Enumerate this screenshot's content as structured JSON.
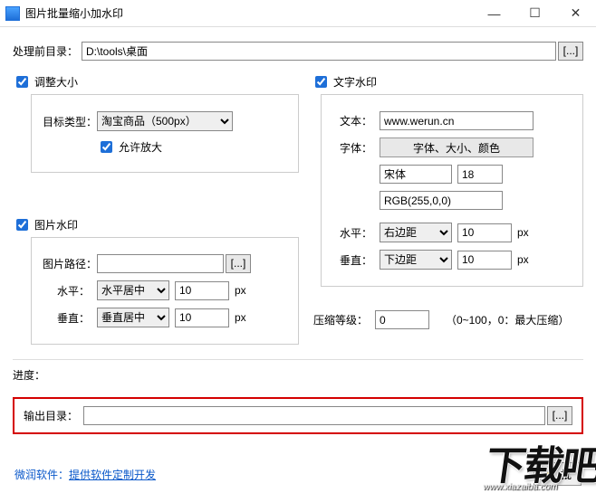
{
  "window": {
    "title": "图片批量缩小加水印",
    "minimize": "—",
    "maximize": "☐",
    "close": "✕"
  },
  "srcdir": {
    "label": "处理前目录：",
    "value": "D:\\tools\\桌面",
    "browse": "[...]"
  },
  "resize": {
    "checkbox": "调整大小",
    "target_label": "目标类型：",
    "target_value": "淘宝商品（500px）",
    "allow_enlarge": "允许放大"
  },
  "imgwm": {
    "checkbox": "图片水印",
    "path_label": "图片路径：",
    "path_value": "",
    "browse": "[...]",
    "h_label": "水平：",
    "h_align": "水平居中",
    "h_offset": "10",
    "h_unit": "px",
    "v_label": "垂直：",
    "v_align": "垂直居中",
    "v_offset": "10",
    "v_unit": "px"
  },
  "textwm": {
    "checkbox": "文字水印",
    "text_label": "文本：",
    "text_value": "www.werun.cn",
    "font_label": "字体：",
    "font_button": "字体、大小、颜色",
    "font_name": "宋体",
    "font_size": "18",
    "font_color": "RGB(255,0,0)",
    "h_label": "水平：",
    "h_align": "右边距",
    "h_offset": "10",
    "h_unit": "px",
    "v_label": "垂直：",
    "v_align": "下边距",
    "v_offset": "10",
    "v_unit": "px"
  },
  "compress": {
    "label": "压缩等级：",
    "value": "0",
    "hint": "（0~100，0：最大压缩）"
  },
  "progress": {
    "label": "进度："
  },
  "outdir": {
    "label": "输出目录：",
    "value": "",
    "browse": "[...]"
  },
  "footer": {
    "brand": "微润软件：",
    "link": "提供软件定制开发"
  },
  "run": {
    "icon": "⚡",
    "label": "批"
  },
  "overlay": {
    "big": "下载吧",
    "url": "www.xiazaiba.com"
  }
}
